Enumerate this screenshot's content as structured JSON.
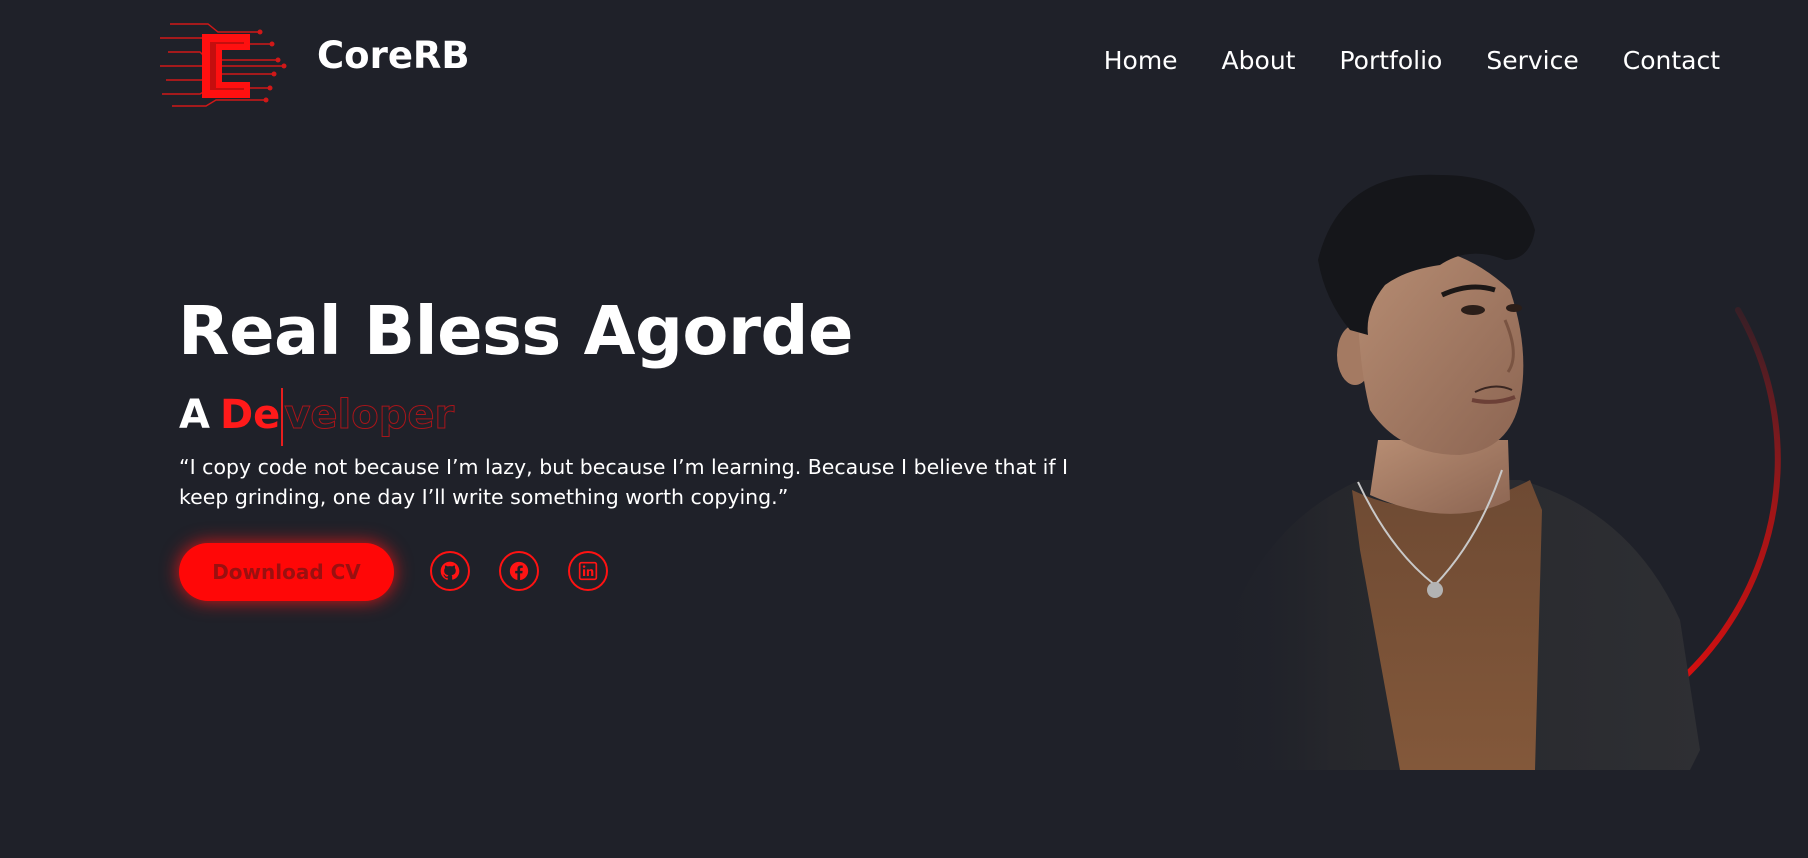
{
  "header": {
    "brand": "CoreRB",
    "logo_icon": "circuit-c-logo",
    "nav": [
      "Home",
      "About",
      "Portfolio",
      "Service",
      "Contact"
    ]
  },
  "hero": {
    "name": "Real Bless Agorde",
    "role_prefix": "A",
    "role_typed": "De",
    "role_remaining": "veloper",
    "quote": "“I copy code not because I’m lazy, but because I’m learning. Because I believe that if I keep grinding, one day I’ll write something worth copying.”",
    "cta_label": "Download CV",
    "social_icons": [
      "github-icon",
      "facebook-icon",
      "linkedin-icon"
    ]
  },
  "colors": {
    "background": "#1f2129",
    "accent": "#ff0707",
    "text": "#ffffff"
  }
}
